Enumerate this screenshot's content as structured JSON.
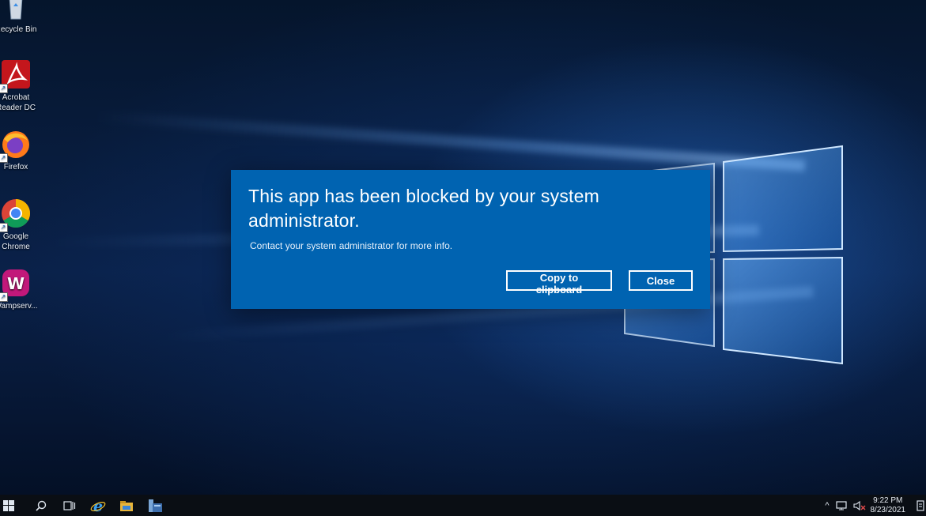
{
  "desktop": {
    "icons": [
      {
        "label_line1": "Recycle Bin",
        "label_line2": "",
        "icon": "recycle-bin-icon"
      },
      {
        "label_line1": "Acrobat",
        "label_line2": "Reader DC",
        "icon": "acrobat-reader-icon"
      },
      {
        "label_line1": "Firefox",
        "label_line2": "",
        "icon": "firefox-icon"
      },
      {
        "label_line1": "Google",
        "label_line2": "Chrome",
        "icon": "chrome-icon"
      },
      {
        "label_line1": "Wampserv...",
        "label_line2": "",
        "icon": "wampserver-icon"
      }
    ]
  },
  "dialog": {
    "title": "This app has been blocked by your system administrator.",
    "message": "Contact your system administrator for more info.",
    "copy_label": "Copy to clipboard",
    "close_label": "Close",
    "background": "#0063b1"
  },
  "taskbar": {
    "time": "9:22 PM",
    "date": "8/23/2021",
    "pinned": [
      "start-icon",
      "search-icon",
      "task-view-icon",
      "internet-explorer-icon",
      "file-explorer-icon",
      "server-manager-icon"
    ]
  }
}
